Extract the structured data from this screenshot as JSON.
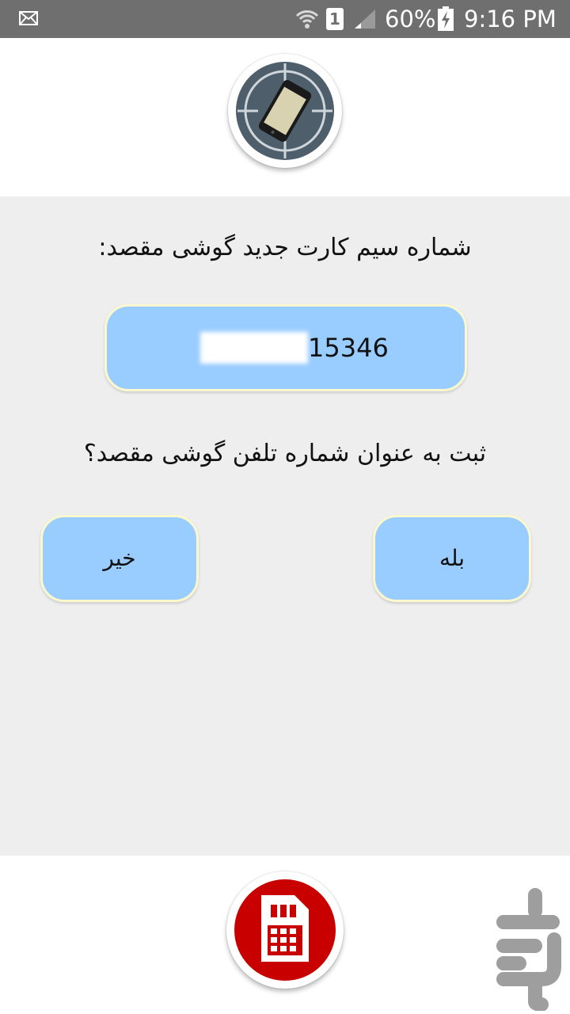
{
  "status_bar": {
    "sim_slot": "1",
    "battery_percent": "60%",
    "time": "9:16 PM",
    "icons": [
      "mail-icon",
      "wifi-icon",
      "sim-slot-icon",
      "signal-icon",
      "battery-charging-icon"
    ]
  },
  "header": {
    "logo_icon": "phone-target-icon"
  },
  "main": {
    "prompt": "شماره سیم کارت جدید گوشی مقصد:",
    "phone_number_visible": "15346",
    "question": "ثبت به عنوان شماره تلفن گوشی مقصد؟",
    "no_label": "خیر",
    "yes_label": "بله"
  },
  "footer": {
    "sim_icon": "sim-card-icon",
    "watermark": "cafebazaar-logo-icon"
  },
  "colors": {
    "status_bar": "#6f6f6f",
    "panel_background": "#eeeeee",
    "button_fill": "#99ccff",
    "button_border": "#fbf7cf",
    "sim_red": "#c80000"
  }
}
